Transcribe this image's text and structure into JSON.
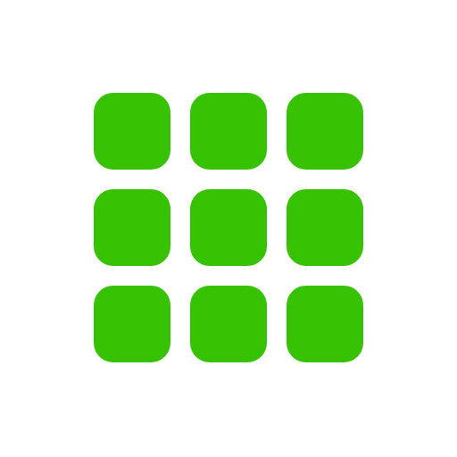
{
  "icon": {
    "name": "app-grid-icon",
    "tile_color": "#37c200",
    "background_color": "#ffffff",
    "rows": 3,
    "columns": 3,
    "tiles": [
      {
        "name": "grid-tile"
      },
      {
        "name": "grid-tile"
      },
      {
        "name": "grid-tile"
      },
      {
        "name": "grid-tile"
      },
      {
        "name": "grid-tile"
      },
      {
        "name": "grid-tile"
      },
      {
        "name": "grid-tile"
      },
      {
        "name": "grid-tile"
      },
      {
        "name": "grid-tile"
      }
    ]
  }
}
